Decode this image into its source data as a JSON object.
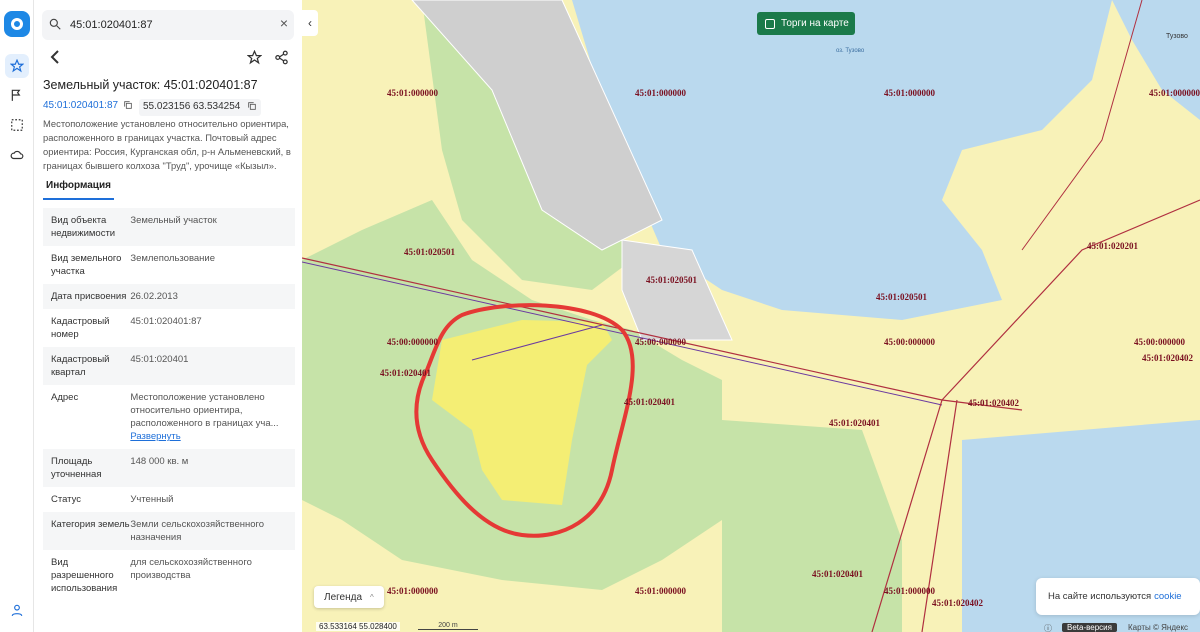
{
  "search": {
    "query": "45:01:020401:87"
  },
  "parcel": {
    "title": "Земельный участок: 45:01:020401:87",
    "cadastral_number": "45:01:020401:87",
    "coordinates": "55.023156 63.534254",
    "description": "Местоположение установлено относительно ориентира, расположенного в границах участка. Почтовый адрес ориентира: Россия, Курганская обл, р-н Альменевский, в границах бывшего колхоза \"Труд\", урочище «Кызыл»."
  },
  "tabs": {
    "info": "Информация"
  },
  "rows": [
    {
      "key": "Вид объекта недвижимости",
      "value": "Земельный участок"
    },
    {
      "key": "Вид земельного участка",
      "value": "Землепользование"
    },
    {
      "key": "Дата присвоения",
      "value": "26.02.2013"
    },
    {
      "key": "Кадастровый номер",
      "value": "45:01:020401:87"
    },
    {
      "key": "Кадастровый квартал",
      "value": "45:01:020401"
    },
    {
      "key": "Адрес",
      "value": "Местоположение установлено относительно ориентира, расположенного в границах уча...",
      "more": "Развернуть"
    },
    {
      "key": "Площадь уточненная",
      "value": "148 000 кв. м"
    },
    {
      "key": "Статус",
      "value": "Учтенный"
    },
    {
      "key": "Категория земель",
      "value": "Земли сельскохозяйственного назначения"
    },
    {
      "key": "Вид разрешенного использования",
      "value": "для сельскохозяйственного производства"
    }
  ],
  "map": {
    "auction_label": "Торги на карте",
    "lake_label": "оз. Тузово",
    "village_label": "Тузово",
    "legend_label": "Легенда",
    "cookie_text": "На сайте используются",
    "cookie_link": "cookie",
    "bottom_coords": "63.533164  55.028400",
    "scale_label": "200 m",
    "beta_label": "Beta-версия",
    "provider": "Карты © Яндекс",
    "info_symbol": "ⓘ",
    "labels": [
      "45:01:000000",
      "45:01:000000",
      "45:01:000000",
      "45:01:000000",
      "45:01:020501",
      "45:01:020501",
      "45:01:020501",
      "45:01:020201",
      "45:00:000000",
      "45:00:000000",
      "45:00:000000",
      "45:00:000000",
      "45:01:020401",
      "45:01:020401",
      "45:01:020401",
      "45:01:020402",
      "45:01:020402",
      "45:01:020401",
      "45:01:000000",
      "45:01:000000",
      "45:01:000000",
      "45:01:020402"
    ],
    "label_color": "#7a1020",
    "highlight_color": "#e53935"
  }
}
